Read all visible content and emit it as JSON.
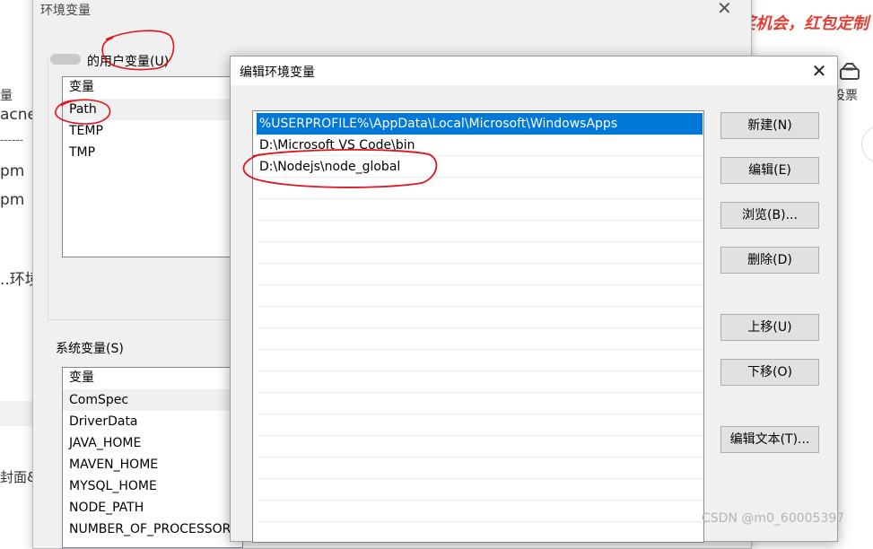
{
  "background": {
    "banner_text": "奖机会，红包定制",
    "fragments": [
      "量",
      "acne",
      "------",
      "pm",
      "pm",
      "..环境",
      "封面&"
    ],
    "vote_icon": "vote-box-icon",
    "vote_label": "投票"
  },
  "env_dialog": {
    "title": "环境变量",
    "close_icon": "close-icon",
    "user_group_label": "的用户变量(U)",
    "user_list": {
      "header": "变量",
      "items": [
        "Path",
        "TEMP",
        "TMP"
      ],
      "selected": "Path"
    },
    "system_group_label": "系统变量(S)",
    "system_list": {
      "header": "变量",
      "items": [
        "ComSpec",
        "DriverData",
        "JAVA_HOME",
        "MAVEN_HOME",
        "MYSQL_HOME",
        "NODE_PATH",
        "NUMBER_OF_PROCESSORS"
      ],
      "selected": "ComSpec"
    }
  },
  "edit_dialog": {
    "title": "编辑环境变量",
    "close_icon": "close-icon",
    "paths": [
      "%USERPROFILE%\\AppData\\Local\\Microsoft\\WindowsApps",
      "D:\\Microsoft VS Code\\bin",
      "D:\\Nodejs\\node_global"
    ],
    "selected_index": 0,
    "buttons": {
      "new": "新建(N)",
      "edit": "编辑(E)",
      "browse": "浏览(B)...",
      "delete": "删除(D)",
      "move_up": "上移(U)",
      "move_down": "下移(O)",
      "edit_text": "编辑文本(T)..."
    }
  },
  "annotation_color": "#e0141e",
  "selection_color": "#0078d7",
  "watermark": "CSDN @m0_60005397"
}
